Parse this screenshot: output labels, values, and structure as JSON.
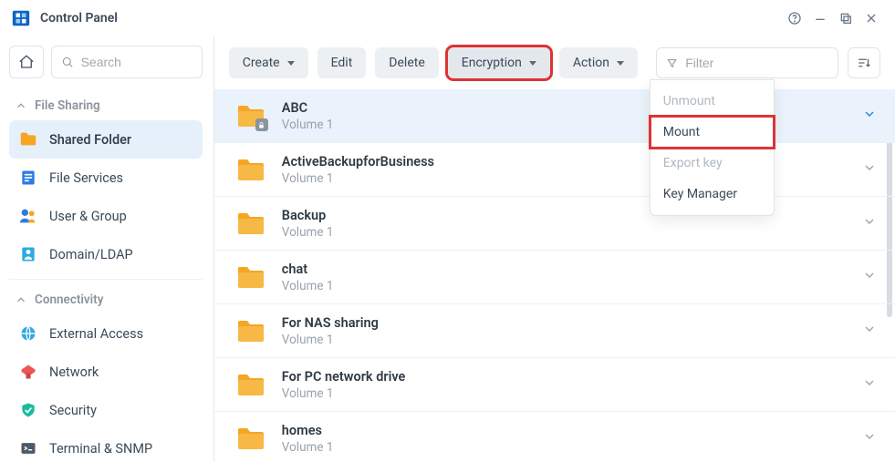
{
  "window": {
    "title": "Control Panel"
  },
  "sidebar": {
    "search_placeholder": "Search",
    "sections": [
      {
        "label": "File Sharing",
        "items": [
          {
            "id": "shared-folder",
            "label": "Shared Folder",
            "active": true
          },
          {
            "id": "file-services",
            "label": "File Services"
          },
          {
            "id": "user-group",
            "label": "User & Group"
          },
          {
            "id": "domain-ldap",
            "label": "Domain/LDAP"
          }
        ]
      },
      {
        "label": "Connectivity",
        "items": [
          {
            "id": "external-access",
            "label": "External Access"
          },
          {
            "id": "network",
            "label": "Network"
          },
          {
            "id": "security",
            "label": "Security"
          },
          {
            "id": "terminal-snmp",
            "label": "Terminal & SNMP"
          }
        ]
      }
    ]
  },
  "toolbar": {
    "create": "Create",
    "edit": "Edit",
    "delete": "Delete",
    "encryption": "Encryption",
    "action": "Action",
    "filter_placeholder": "Filter"
  },
  "encryption_menu": {
    "unmount": "Unmount",
    "mount": "Mount",
    "export_key": "Export key",
    "key_manager": "Key Manager"
  },
  "folders": [
    {
      "name": "ABC",
      "sub": "Volume 1",
      "locked": true,
      "selected": true
    },
    {
      "name": "ActiveBackupforBusiness",
      "sub": "Volume 1"
    },
    {
      "name": "Backup",
      "sub": "Volume 1"
    },
    {
      "name": "chat",
      "sub": "Volume 1"
    },
    {
      "name": "For NAS sharing",
      "sub": "Volume 1"
    },
    {
      "name": "For PC network drive",
      "sub": "Volume 1"
    },
    {
      "name": "homes",
      "sub": "Volume 1"
    }
  ]
}
